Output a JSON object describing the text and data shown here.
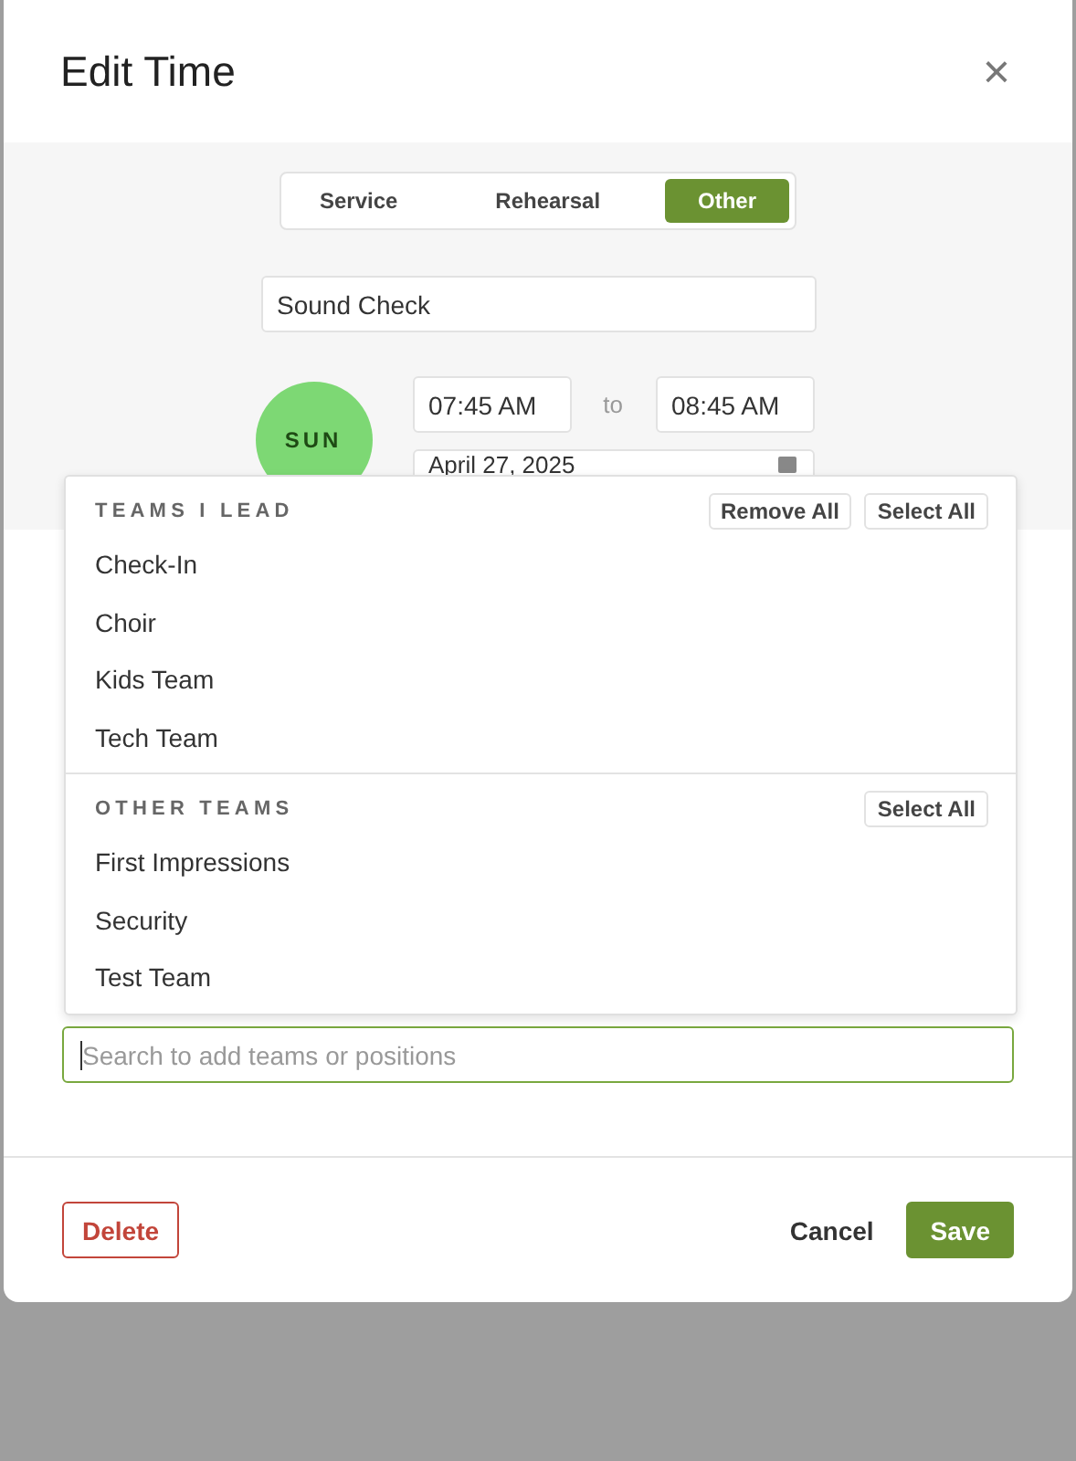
{
  "dialog": {
    "title": "Edit Time",
    "close": "×"
  },
  "tabs": [
    {
      "label": "Service",
      "selected": false
    },
    {
      "label": "Rehearsal",
      "selected": false
    },
    {
      "label": "Other",
      "selected": true
    }
  ],
  "name_field": {
    "value": "Sound Check"
  },
  "day_badge": "SUN",
  "start_time": "07:45 AM",
  "separator": "to",
  "end_time": "08:45 AM",
  "date_field": {
    "value": "April 27, 2025"
  },
  "team_menu": [
    {
      "heading": "TEAMS I LEAD",
      "actions": [
        "Remove All",
        "Select All"
      ],
      "items": [
        "Check-In",
        "Choir",
        "Kids Team",
        "Tech Team"
      ]
    },
    {
      "heading": "OTHER TEAMS",
      "actions": [
        "Select All"
      ],
      "items": [
        "First Impressions",
        "Security",
        "Test Team"
      ]
    }
  ],
  "search_field": {
    "placeholder": "Search to add teams or positions"
  },
  "buttons": [
    {
      "label": "Delete",
      "kind": "danger"
    },
    {
      "label": "Cancel",
      "kind": "plain"
    },
    {
      "label": "Save",
      "kind": "primary"
    }
  ]
}
